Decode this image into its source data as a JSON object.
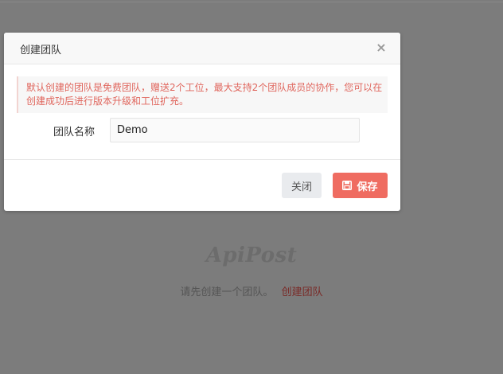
{
  "background": {
    "logo_text": "ApiPost",
    "prompt_text": "请先创建一个团队。",
    "create_team_link": "创建团队"
  },
  "modal": {
    "title": "创建团队",
    "close_icon": "×",
    "notice": "默认创建的团队是免费团队，赠送2个工位，最大支持2个团队成员的协作，您可以在创建成功后进行版本升级和工位扩充。",
    "team_name_label": "团队名称",
    "team_name_value": "Demo",
    "close_button": "关闭",
    "save_button": "保存"
  },
  "colors": {
    "accent": "#ef6c61",
    "notice_text": "#e0665d",
    "overlay": "#7c7c7c"
  }
}
